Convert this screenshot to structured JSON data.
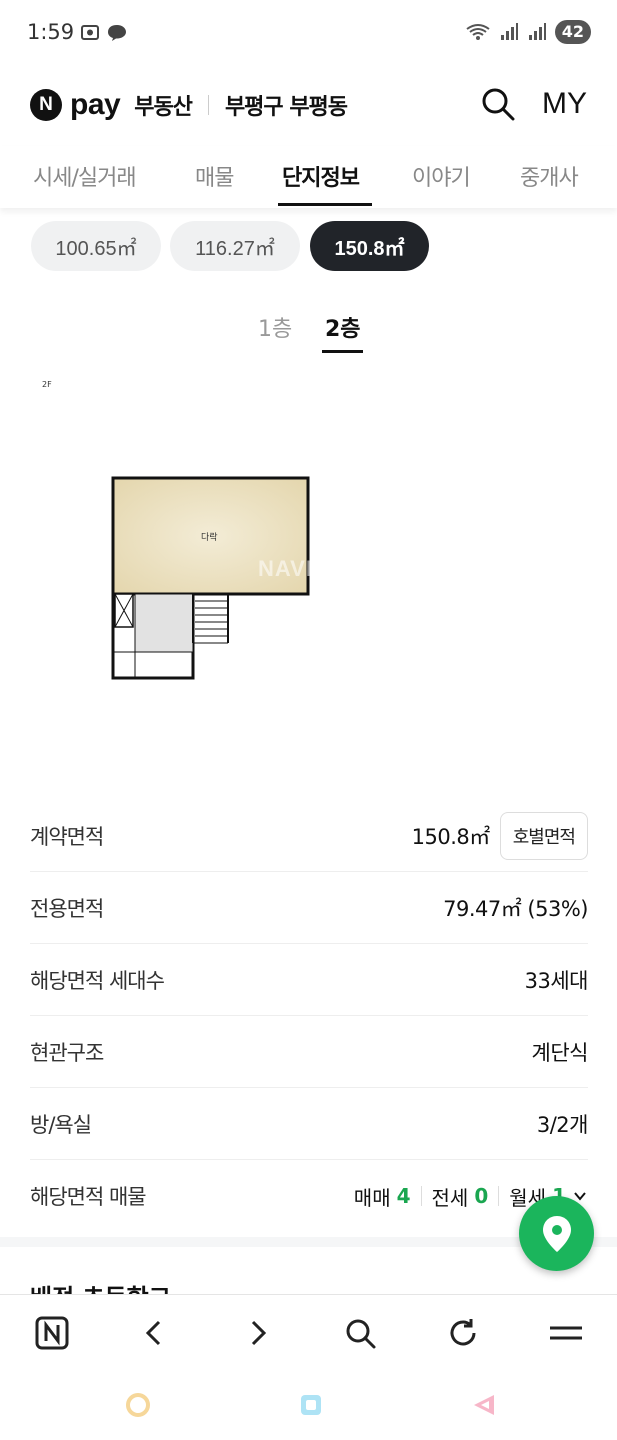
{
  "status_bar": {
    "time": "1:59",
    "battery": "42"
  },
  "header": {
    "logo_n": "N",
    "logo_pay": "pay",
    "service": "부동산",
    "region": "부평구 부평동",
    "my_label": "MY"
  },
  "tabs": [
    {
      "label": "시세/실거래"
    },
    {
      "label": "매물"
    },
    {
      "label": "단지정보",
      "active": true
    },
    {
      "label": "이야기"
    },
    {
      "label": "중개사"
    }
  ],
  "area_chips": [
    {
      "label": "100.65㎡"
    },
    {
      "label": "116.27㎡"
    },
    {
      "label": "150.8㎡",
      "active": true
    }
  ],
  "floor_tabs": [
    {
      "label": "1층"
    },
    {
      "label": "2층",
      "active": true
    }
  ],
  "floorplan": {
    "floor_label": "2F",
    "room_label": "다락",
    "watermark": "NAVER"
  },
  "info_rows": {
    "contract_area": {
      "label": "계약면적",
      "value": "150.8㎡",
      "button": "호별면적"
    },
    "exclusive_area": {
      "label": "전용면적",
      "value": "79.47㎡ (53%)"
    },
    "households": {
      "label": "해당면적 세대수",
      "value": "33세대"
    },
    "entrance": {
      "label": "현관구조",
      "value": "계단식"
    },
    "rooms": {
      "label": "방/욕실",
      "value": "3/2개"
    },
    "listings": {
      "label": "해당면적 매물",
      "sale_label": "매매",
      "sale_count": "4",
      "jeonse_label": "전세",
      "jeonse_count": "0",
      "monthly_label": "월세",
      "monthly_count": "1"
    }
  },
  "next_section_heading": "배정 초등학교",
  "colors": {
    "accent_green": "#1bb55c",
    "active_chip": "#212429"
  }
}
